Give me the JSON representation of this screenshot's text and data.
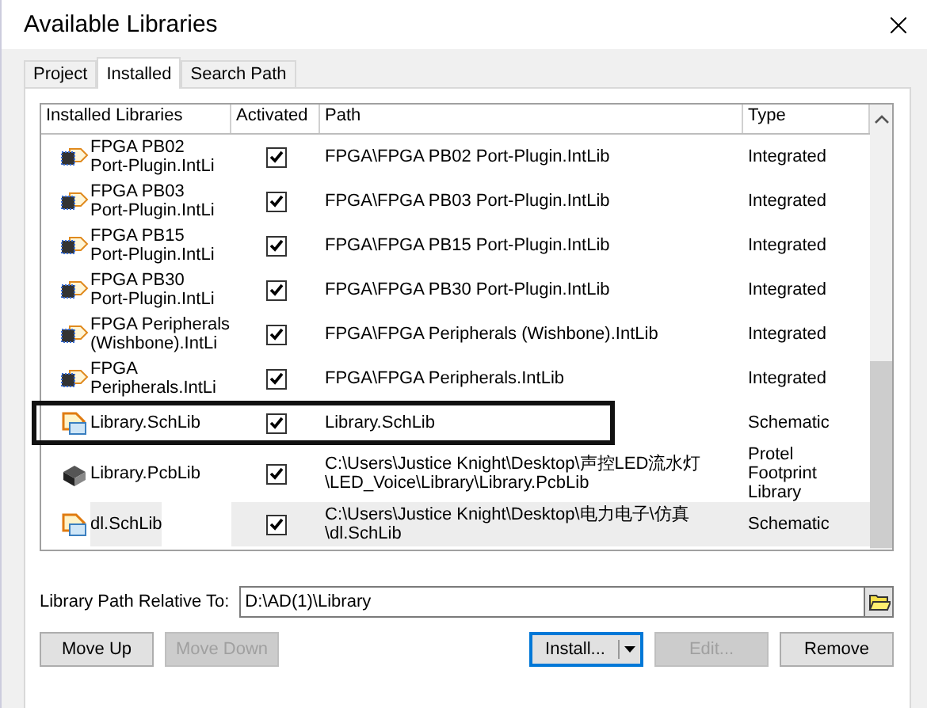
{
  "window": {
    "title": "Available Libraries"
  },
  "tabs": [
    {
      "label": "Project",
      "selected": false
    },
    {
      "label": "Installed",
      "selected": true
    },
    {
      "label": "Search Path",
      "selected": false
    }
  ],
  "table": {
    "columns": [
      "Installed Libraries",
      "Activated",
      "Path",
      "Type"
    ],
    "rows": [
      {
        "kind": "integrated",
        "name": "FPGA PB02\nPort-Plugin.IntLi",
        "activated": true,
        "path": "FPGA\\FPGA PB02 Port-Plugin.IntLib",
        "type": "Integrated",
        "selected": false,
        "highlighted": false
      },
      {
        "kind": "integrated",
        "name": "FPGA PB03\nPort-Plugin.IntLi",
        "activated": true,
        "path": "FPGA\\FPGA PB03 Port-Plugin.IntLib",
        "type": "Integrated",
        "selected": false,
        "highlighted": false
      },
      {
        "kind": "integrated",
        "name": "FPGA PB15\nPort-Plugin.IntLi",
        "activated": true,
        "path": "FPGA\\FPGA PB15 Port-Plugin.IntLib",
        "type": "Integrated",
        "selected": false,
        "highlighted": false
      },
      {
        "kind": "integrated",
        "name": "FPGA PB30\nPort-Plugin.IntLi",
        "activated": true,
        "path": "FPGA\\FPGA PB30 Port-Plugin.IntLib",
        "type": "Integrated",
        "selected": false,
        "highlighted": false
      },
      {
        "kind": "integrated",
        "name": "FPGA Peripherals\n(Wishbone).IntLi",
        "activated": true,
        "path": "FPGA\\FPGA Peripherals (Wishbone).IntLib",
        "type": "Integrated",
        "selected": false,
        "highlighted": false
      },
      {
        "kind": "integrated",
        "name": "FPGA\nPeripherals.IntLi",
        "activated": true,
        "path": "FPGA\\FPGA Peripherals.IntLib",
        "type": "Integrated",
        "selected": false,
        "highlighted": false
      },
      {
        "kind": "schematic",
        "name": "Library.SchLib",
        "activated": true,
        "path": "Library.SchLib",
        "type": "Schematic",
        "selected": false,
        "highlighted": true
      },
      {
        "kind": "pcb",
        "name": "Library.PcbLib",
        "activated": true,
        "path": "C:\\Users\\Justice Knight\\Desktop\\声控LED流水灯\n\\LED_Voice\\Library\\Library.PcbLib",
        "type": "Protel\nFootprint\nLibrary",
        "selected": false,
        "highlighted": false
      },
      {
        "kind": "schematic",
        "name": "dl.SchLib",
        "activated": true,
        "path": "C:\\Users\\Justice Knight\\Desktop\\电力电子\\仿真\n\\dl.SchLib",
        "type": "Schematic",
        "selected": true,
        "highlighted": false
      }
    ]
  },
  "relative_path": {
    "label": "Library Path Relative To:",
    "value": "D:\\AD(1)\\Library"
  },
  "buttons": [
    {
      "label": "Move Up",
      "disabled": false,
      "kind": "plain"
    },
    {
      "label": "Move Down",
      "disabled": true,
      "kind": "plain"
    },
    {
      "label": "Install...",
      "disabled": false,
      "kind": "split"
    },
    {
      "label": "Edit...",
      "disabled": true,
      "kind": "plain"
    },
    {
      "label": "Remove",
      "disabled": false,
      "kind": "plain"
    }
  ]
}
